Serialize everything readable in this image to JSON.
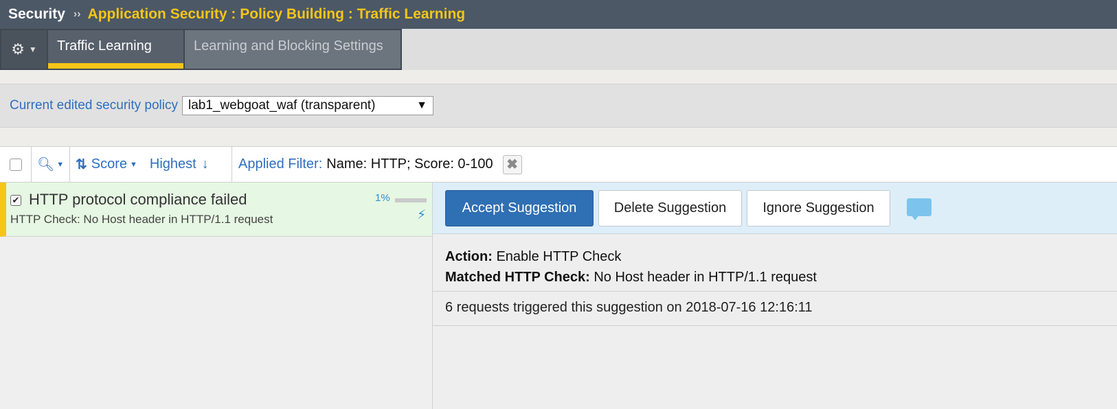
{
  "header": {
    "section": "Security",
    "separator": "››",
    "breadcrumb": "Application Security : Policy Building : Traffic Learning"
  },
  "tabs": [
    {
      "label": "Traffic Learning",
      "active": true
    },
    {
      "label": "Learning and Blocking Settings",
      "active": false
    }
  ],
  "policy": {
    "label": "Current edited security policy",
    "selected": "lab1_webgoat_waf (transparent)"
  },
  "toolbar": {
    "sort_label": "Score",
    "order_label": "Highest",
    "filter_label": "Applied Filter:",
    "filter_value": "Name: HTTP; Score: 0-100"
  },
  "suggestions": [
    {
      "title": "HTTP protocol compliance failed",
      "subtitle": "HTTP Check: No Host header in HTTP/1.1 request",
      "score_text": "1%",
      "score": 0.01,
      "checked": true
    }
  ],
  "actions": {
    "accept": "Accept Suggestion",
    "delete": "Delete Suggestion",
    "ignore": "Ignore Suggestion"
  },
  "details": {
    "action_label": "Action:",
    "action_value": "Enable HTTP Check",
    "matched_label": "Matched HTTP Check:",
    "matched_value": "No Host header in HTTP/1.1 request",
    "requests_text": "6 requests triggered this suggestion on 2018-07-16 12:16:11"
  },
  "colors": {
    "header_bg": "#4c5866",
    "accent_yellow": "#f5c518",
    "link_blue": "#2f6fbf",
    "primary_button": "#2f6fb3",
    "suggestion_bg": "#e6f7e3"
  }
}
